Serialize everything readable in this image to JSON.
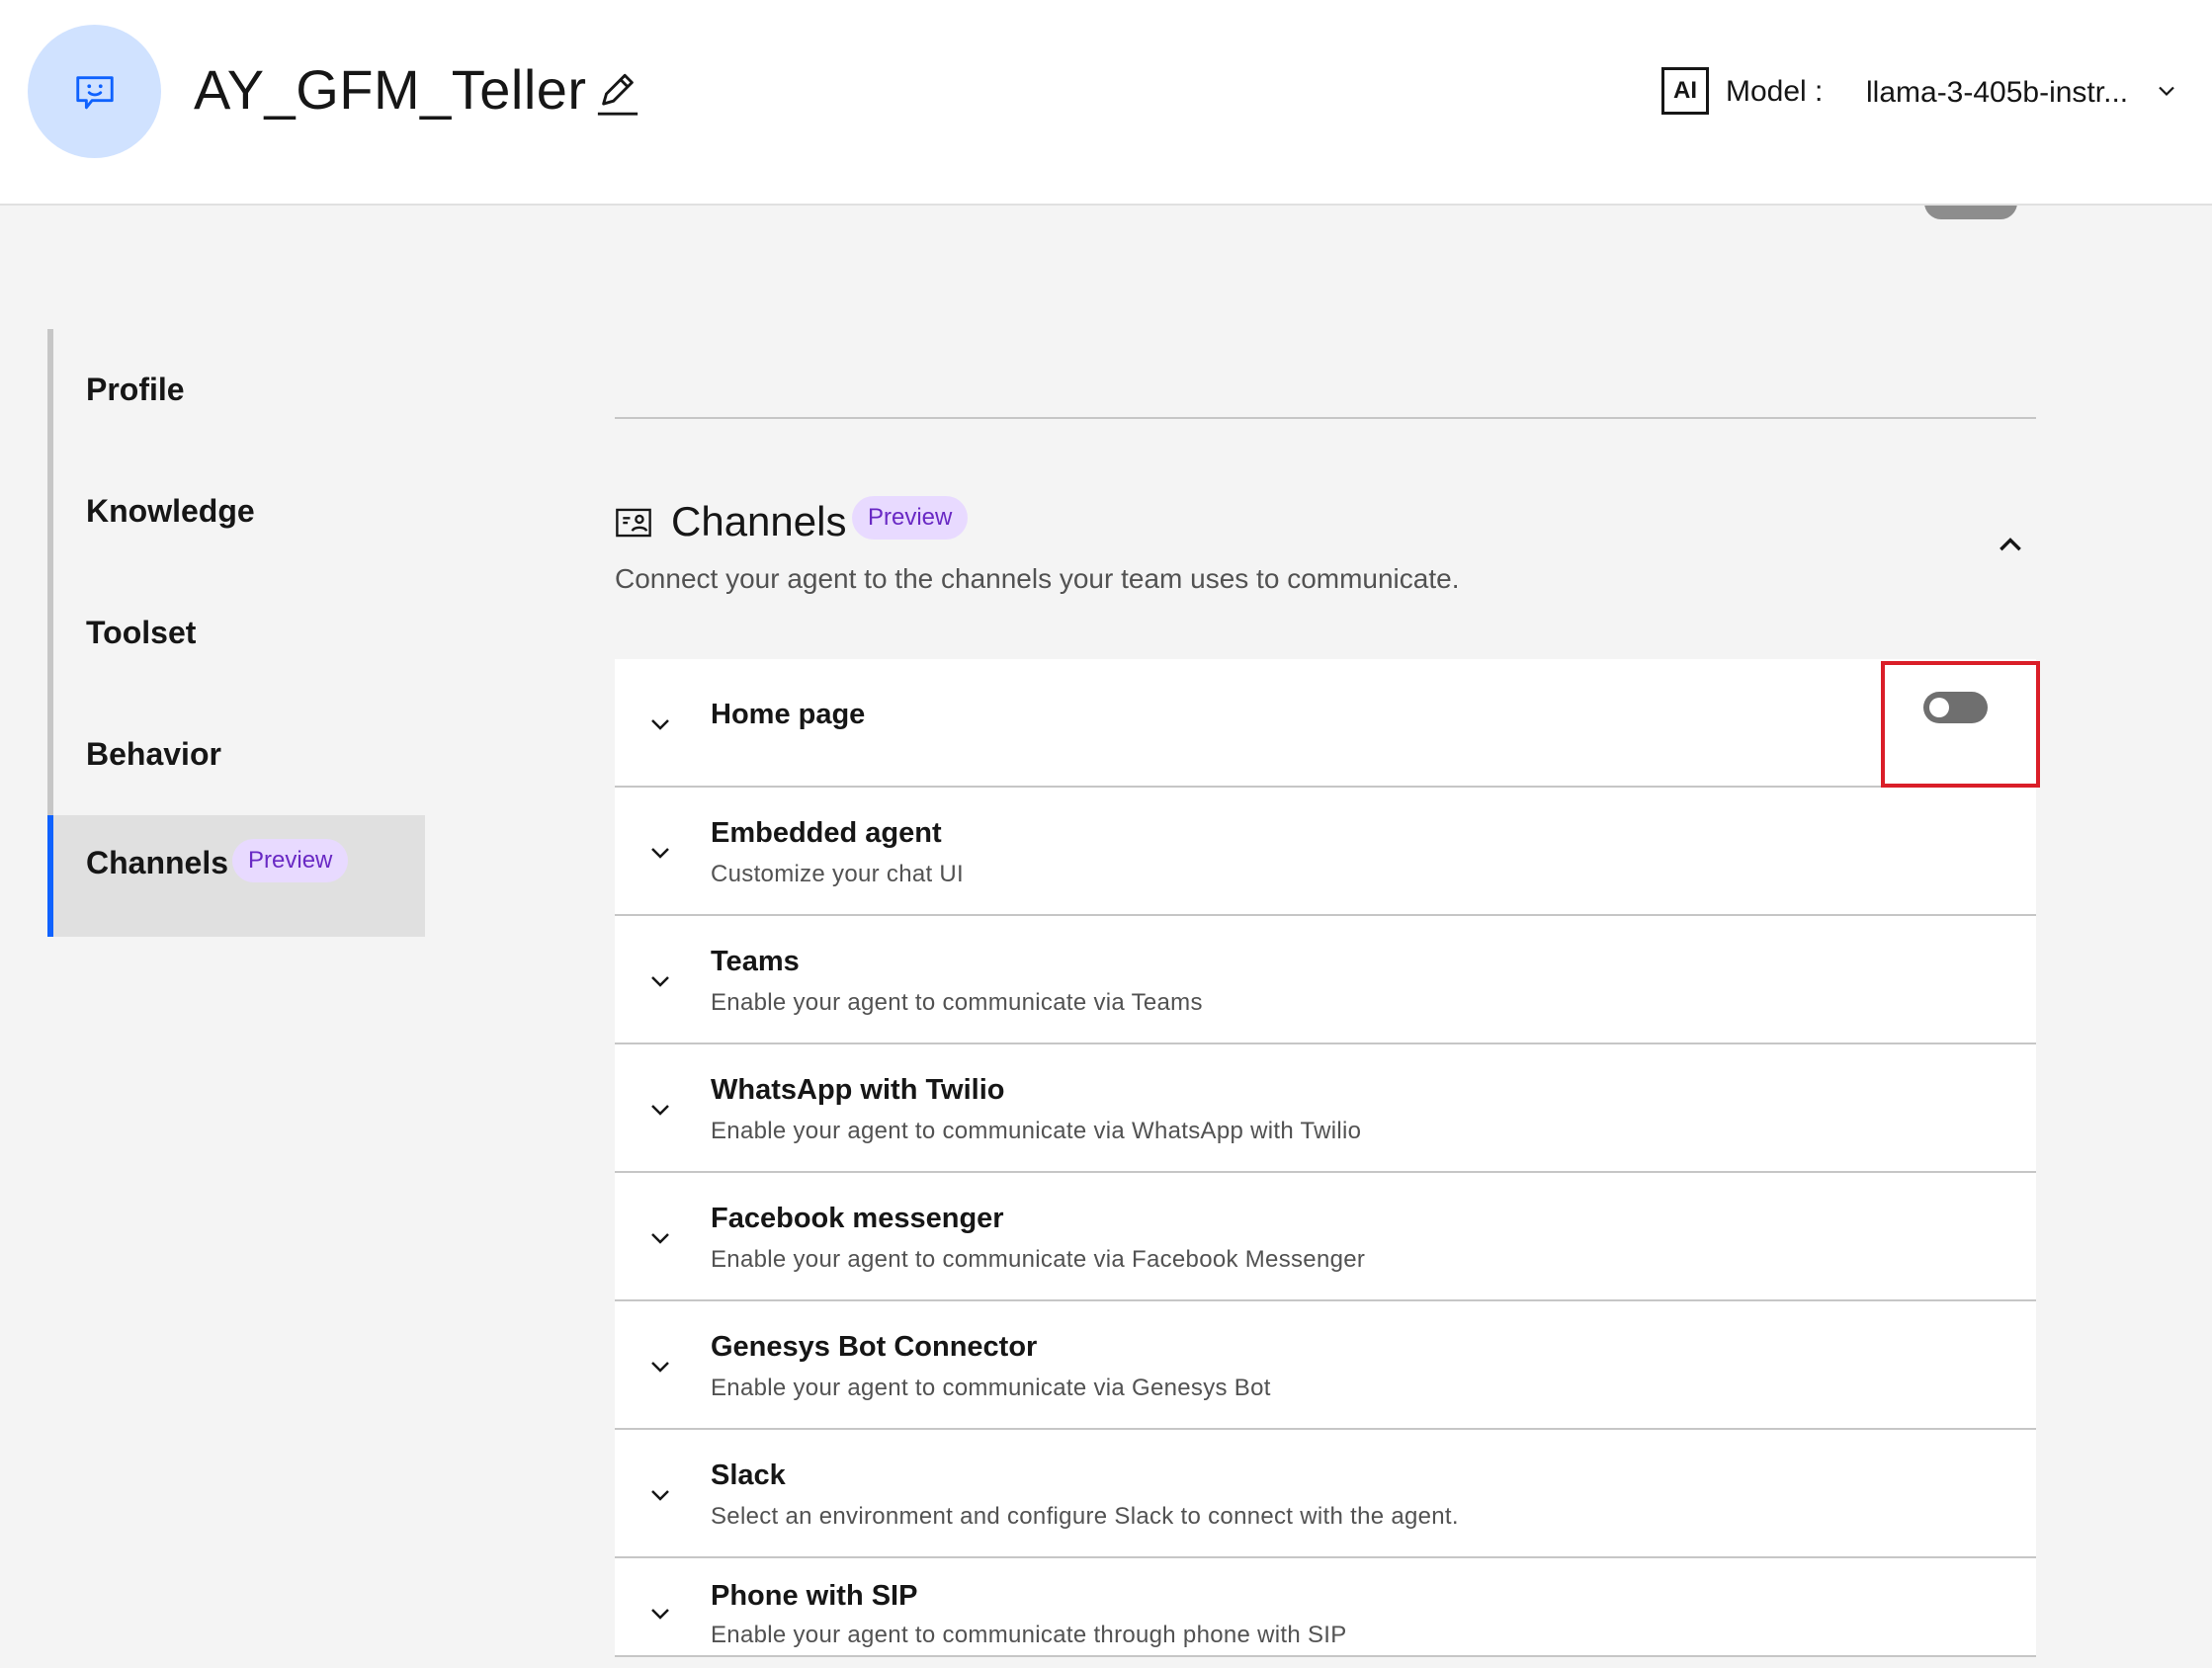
{
  "header": {
    "agent_name": "AY_GFM_Teller",
    "ai_badge": "AI",
    "model_label": "Model :",
    "model_value": "llama-3-405b-instr..."
  },
  "sidenav": {
    "items": [
      {
        "label": "Profile"
      },
      {
        "label": "Knowledge"
      },
      {
        "label": "Toolset"
      },
      {
        "label": "Behavior"
      },
      {
        "label": "Channels",
        "badge": "Preview",
        "active": true
      }
    ]
  },
  "channels": {
    "title": "Channels",
    "badge": "Preview",
    "description": "Connect your agent to the channels your team uses to communicate.",
    "rows": [
      {
        "title": "Home page",
        "subtitle": "",
        "toggle_enabled": false
      },
      {
        "title": "Embedded agent",
        "subtitle": "Customize your chat UI"
      },
      {
        "title": "Teams",
        "subtitle": "Enable your agent to communicate via Teams"
      },
      {
        "title": "WhatsApp with Twilio",
        "subtitle": "Enable your agent to communicate via WhatsApp with Twilio"
      },
      {
        "title": "Facebook messenger",
        "subtitle": "Enable your agent to communicate via Facebook Messenger"
      },
      {
        "title": "Genesys Bot Connector",
        "subtitle": "Enable your agent to communicate via Genesys Bot"
      },
      {
        "title": "Slack",
        "subtitle": "Select an environment and configure Slack to connect with the agent."
      },
      {
        "title": "Phone with SIP",
        "subtitle": "Enable your agent to communicate through phone with SIP"
      }
    ]
  },
  "colors": {
    "accent": "#0f62fe",
    "preview_badge_bg": "#e8daff",
    "preview_badge_text": "#6929c4",
    "highlight": "#da1e28",
    "avatar_bg": "#d0e2ff"
  }
}
